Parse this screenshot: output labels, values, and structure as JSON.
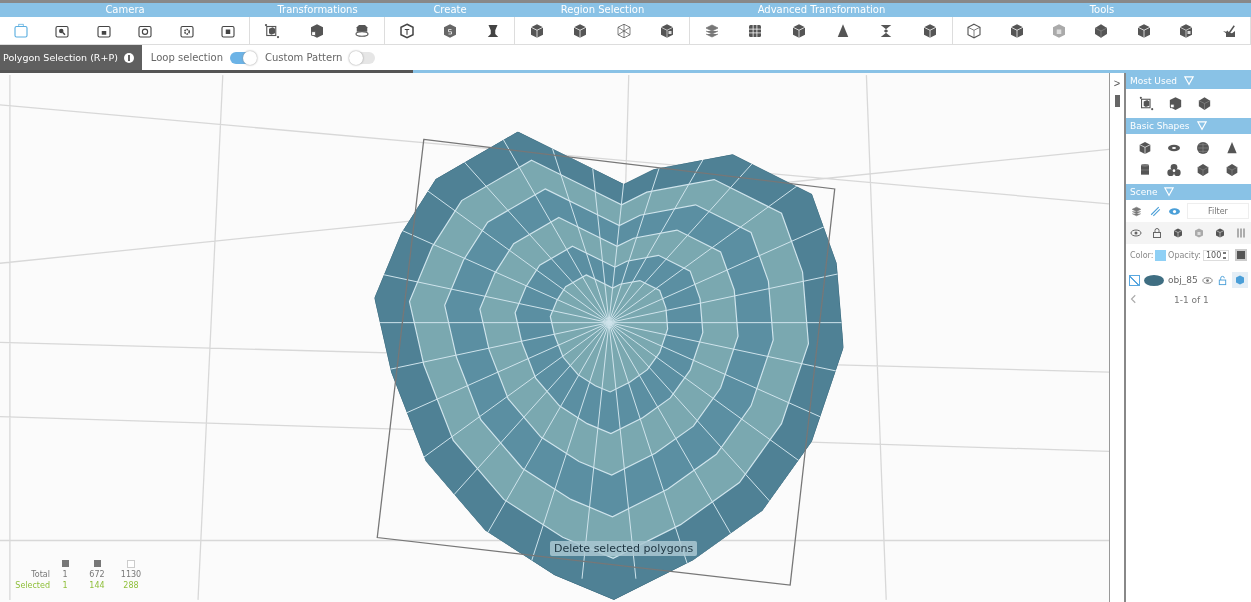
{
  "toolbar": {
    "groups": [
      {
        "label": "Camera"
      },
      {
        "label": "Transformations"
      },
      {
        "label": "Create"
      },
      {
        "label": "Region Selection"
      },
      {
        "label": "Advanced Transformation"
      },
      {
        "label": "Tools"
      }
    ]
  },
  "options": {
    "mode": "Polygon Selection (R+P)",
    "toggles": [
      {
        "label": "Loop selection",
        "on": true
      },
      {
        "label": "Custom Pattern",
        "on": false
      }
    ],
    "progress": {
      "level": 0.33
    }
  },
  "viewport": {
    "hint": "Delete selected polygons",
    "stats": {
      "total_label": "Total",
      "selected_label": "Selected",
      "columns": [
        {
          "total": "1",
          "selected": "1"
        },
        {
          "total": "672",
          "selected": "144"
        },
        {
          "total": "1130",
          "selected": "288"
        }
      ]
    }
  },
  "side": {
    "collapse": ">",
    "most_used": {
      "title": "Most Used"
    },
    "basic_shapes": {
      "title": "Basic Shapes"
    },
    "scene": {
      "title": "Scene",
      "filter_placeholder": "Filter",
      "color_label": "Color:",
      "color": "#8fd0f5",
      "opacity_label": "Opacity:",
      "opacity": "100",
      "objects": [
        {
          "name": "obj_85",
          "checked": true
        }
      ],
      "pagination": "1-1 of 1"
    }
  }
}
